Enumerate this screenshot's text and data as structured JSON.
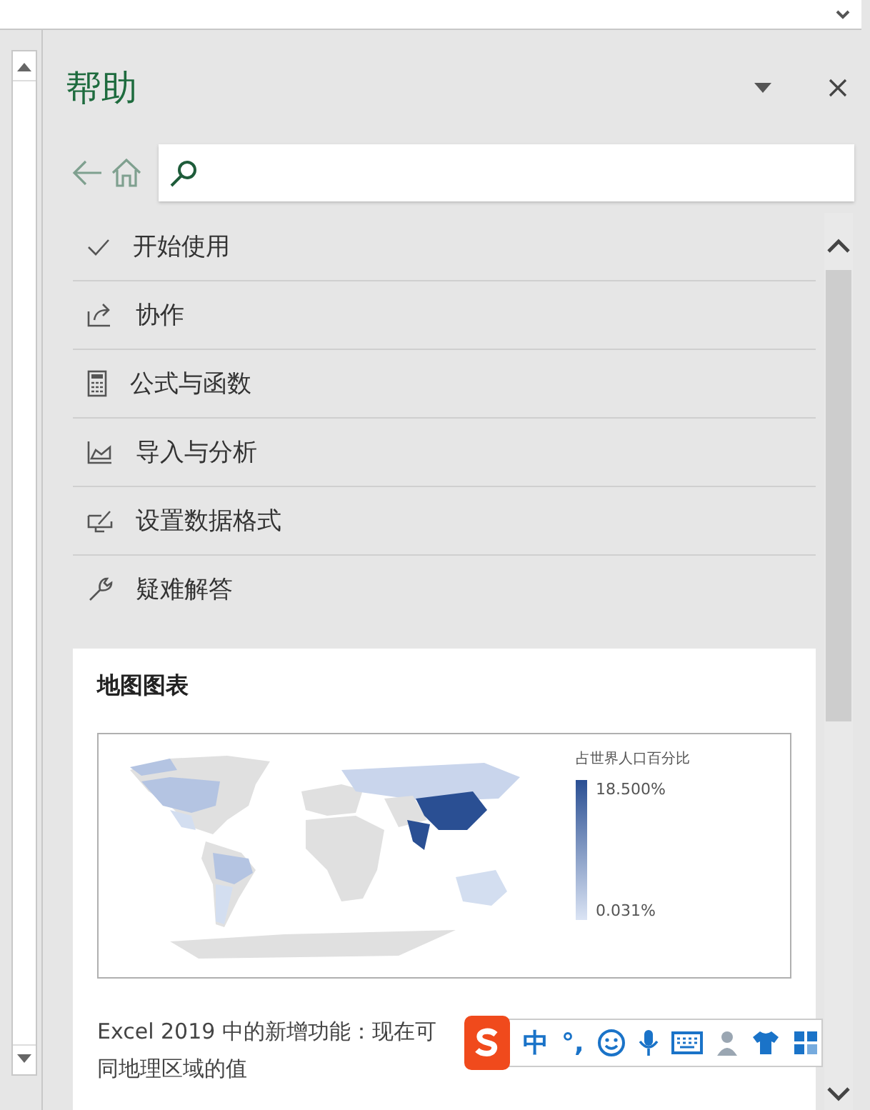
{
  "pane": {
    "title": "帮助"
  },
  "menu": [
    {
      "label": "开始使用"
    },
    {
      "label": "协作"
    },
    {
      "label": "公式与函数"
    },
    {
      "label": "导入与分析"
    },
    {
      "label": "设置数据格式"
    },
    {
      "label": "疑难解答"
    }
  ],
  "card": {
    "title": "地图图表",
    "legend": {
      "title": "占世界人口百分比",
      "max": "18.500%",
      "min": "0.031%"
    },
    "text_lines": [
      "Excel 2019 中的新增功能：现在可",
      "同地理区域的值"
    ]
  },
  "ime": {
    "mode": "中",
    "punct": "°,"
  }
}
